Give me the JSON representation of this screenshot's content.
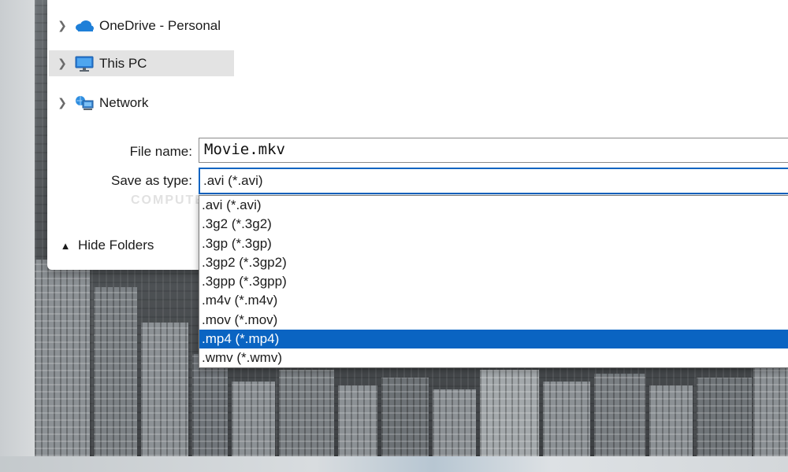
{
  "navigation": {
    "items": [
      {
        "label": "OneDrive - Personal",
        "icon": "cloud-icon",
        "selected": false
      },
      {
        "label": "This PC",
        "icon": "monitor-icon",
        "selected": true
      },
      {
        "label": "Network",
        "icon": "network-icon",
        "selected": false
      }
    ]
  },
  "form": {
    "file_name_label": "File name:",
    "file_name_value": "Movie.mkv",
    "save_type_label": "Save as type:",
    "save_type_value": ".avi (*.avi)"
  },
  "dropdown": {
    "options": [
      ".avi (*.avi)",
      ".3g2 (*.3g2)",
      ".3gp (*.3gp)",
      ".3gp2 (*.3gp2)",
      ".3gpp (*.3gpp)",
      ".m4v (*.m4v)",
      ".mov (*.mov)",
      ".mp4 (*.mp4)",
      ".wmv (*.wmv)"
    ],
    "highlighted_index": 7
  },
  "footer": {
    "hide_folders_label": "Hide Folders"
  },
  "watermark": "COMPUTERV",
  "colors": {
    "accent": "#0a64c2",
    "selected_nav": "#e3e3e3",
    "onedrive": "#1e7fd8"
  }
}
